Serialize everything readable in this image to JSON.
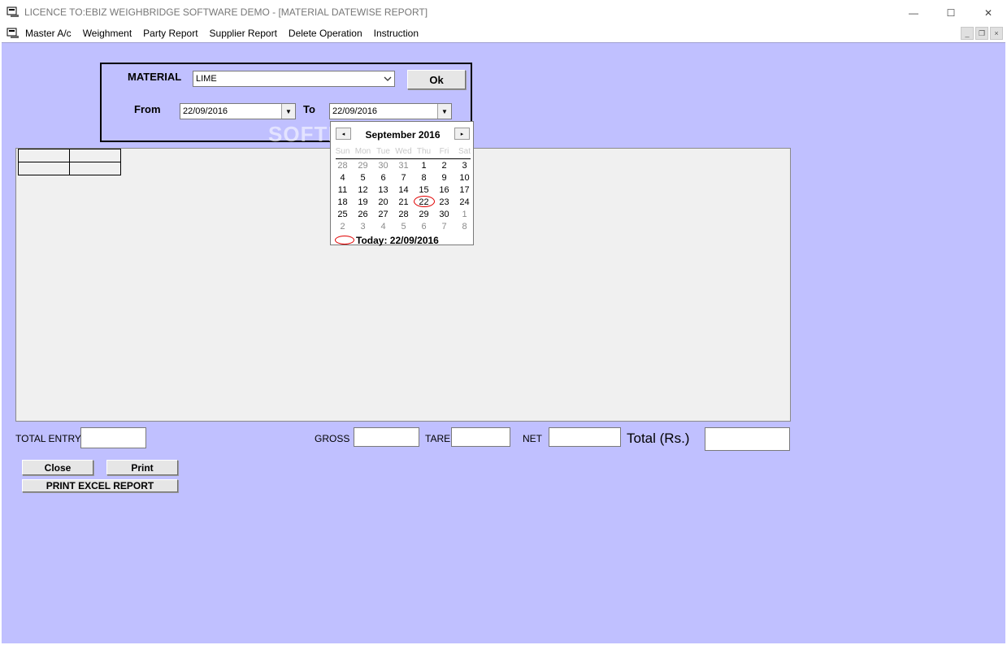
{
  "window": {
    "title": "LICENCE TO:EBIZ WEIGHBRIDGE SOFTWARE DEMO - [MATERIAL DATEWISE REPORT]",
    "minimize": "—",
    "maximize": "☐",
    "close": "✕"
  },
  "menu": {
    "items": [
      "Master A/c",
      "Weighment",
      "Party Report",
      "Supplier Report",
      "Delete Operation",
      "Instruction"
    ],
    "mdi_minimize": "_",
    "mdi_restore": "❐",
    "mdi_close": "×"
  },
  "filter": {
    "material_label": "MATERIAL",
    "material_value": "LIME",
    "ok_label": "Ok",
    "from_label": "From",
    "from_value": "22/09/2016",
    "to_label": "To",
    "to_value": "22/09/2016"
  },
  "calendar": {
    "month_title": "September 2016",
    "prev": "◂",
    "next": "▸",
    "dow": [
      "Sun",
      "Mon",
      "Tue",
      "Wed",
      "Thu",
      "Fri",
      "Sat"
    ],
    "weeks": [
      [
        "28",
        "29",
        "30",
        "31",
        "1",
        "2",
        "3"
      ],
      [
        "4",
        "5",
        "6",
        "7",
        "8",
        "9",
        "10"
      ],
      [
        "11",
        "12",
        "13",
        "14",
        "15",
        "16",
        "17"
      ],
      [
        "18",
        "19",
        "20",
        "21",
        "22",
        "23",
        "24"
      ],
      [
        "25",
        "26",
        "27",
        "28",
        "29",
        "30",
        "1"
      ],
      [
        "2",
        "3",
        "4",
        "5",
        "6",
        "7",
        "8"
      ]
    ],
    "today_text": "Today: 22/09/2016",
    "accent_color": "#e00000"
  },
  "totals": {
    "total_entry_label": "TOTAL ENTRY",
    "gross_label": "GROSS",
    "tare_label": "TARE",
    "net_label": "NET",
    "total_rs_label": "Total (Rs.)"
  },
  "buttons": {
    "close": "Close",
    "print": "Print",
    "excel": "PRINT EXCEL REPORT"
  },
  "watermark": "SOFTPEDIA",
  "colors": {
    "form_background": "#c0c0ff",
    "grid_background": "#f0f0f0"
  }
}
